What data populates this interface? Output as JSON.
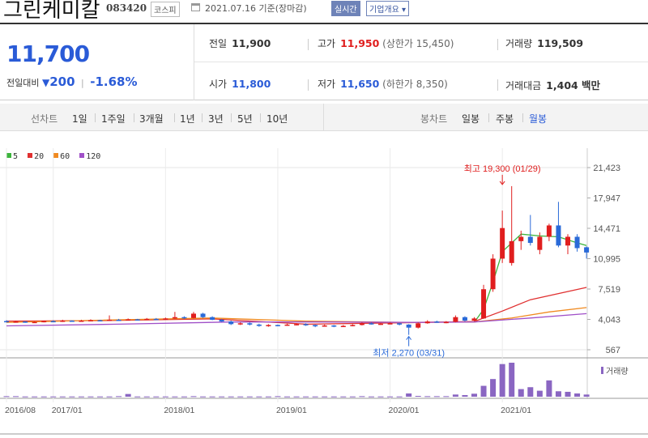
{
  "header": {
    "company_name": "그린케미칼",
    "code": "083420",
    "market": "코스피",
    "date_text": "2021.07.16 기준(장마감)",
    "realtime": "실시간",
    "company_info": "기업개요"
  },
  "quote": {
    "price": "11,700",
    "change_label": "전일대비",
    "change_value": "200",
    "change_pct": "-1.68%",
    "prev_label": "전일",
    "prev_value": "11,900",
    "high_label": "고가",
    "high_value": "11,950",
    "upper_limit": "(상한가 15,450)",
    "volume_label": "거래량",
    "volume_value": "119,509",
    "open_label": "시가",
    "open_value": "11,800",
    "low_label": "저가",
    "low_value": "11,650",
    "lower_limit": "(하한가 8,350)",
    "amount_label": "거래대금",
    "amount_value": "1,404 백만"
  },
  "period_bar": {
    "line_label": "선차트",
    "line_items": [
      "1일",
      "1주일",
      "3개월",
      "1년",
      "3년",
      "5년",
      "10년"
    ],
    "candle_label": "봉차트",
    "candle_items": [
      "일봉",
      "주봉",
      "월봉"
    ],
    "candle_active": "월봉"
  },
  "legend": [
    {
      "label": "5",
      "color": "#3cb43c"
    },
    {
      "label": "20",
      "color": "#e03030"
    },
    {
      "label": "60",
      "color": "#f08a20"
    },
    {
      "label": "120",
      "color": "#a050c8"
    }
  ],
  "chart_data": {
    "type": "candlestick",
    "y_ticks": [
      "21,423",
      "17,947",
      "14,471",
      "10,995",
      "7,519",
      "4,043",
      "567"
    ],
    "y_min": 567,
    "y_max": 21423,
    "x_ticks": [
      {
        "label": "2016/08",
        "i": 0
      },
      {
        "label": "2017/01",
        "i": 5
      },
      {
        "label": "2018/01",
        "i": 17
      },
      {
        "label": "2019/01",
        "i": 29
      },
      {
        "label": "2020/01",
        "i": 41
      },
      {
        "label": "2021/01",
        "i": 53
      }
    ],
    "max_annotation": {
      "text": "최고 19,300 (01/29)",
      "i": 53,
      "value": 19300
    },
    "min_annotation": {
      "text": "최저 2,270 (03/31)",
      "i": 43,
      "value": 2270
    },
    "volume_label": "거래량",
    "candles": [
      {
        "o": 3850,
        "c": 3750,
        "h": 3950,
        "l": 3700
      },
      {
        "o": 3750,
        "c": 3800,
        "h": 3900,
        "l": 3700
      },
      {
        "o": 3800,
        "c": 3700,
        "h": 3850,
        "l": 3650
      },
      {
        "o": 3700,
        "c": 3750,
        "h": 3800,
        "l": 3650
      },
      {
        "o": 3750,
        "c": 3850,
        "h": 3900,
        "l": 3700
      },
      {
        "o": 3850,
        "c": 3800,
        "h": 3950,
        "l": 3750
      },
      {
        "o": 3800,
        "c": 3900,
        "h": 4000,
        "l": 3750
      },
      {
        "o": 3900,
        "c": 3850,
        "h": 3950,
        "l": 3800
      },
      {
        "o": 3850,
        "c": 3900,
        "h": 4000,
        "l": 3800
      },
      {
        "o": 3900,
        "c": 3950,
        "h": 4050,
        "l": 3850
      },
      {
        "o": 3950,
        "c": 3900,
        "h": 4000,
        "l": 3850
      },
      {
        "o": 3900,
        "c": 4000,
        "h": 4500,
        "l": 3850
      },
      {
        "o": 4000,
        "c": 3950,
        "h": 4100,
        "l": 3900
      },
      {
        "o": 3950,
        "c": 4050,
        "h": 4150,
        "l": 3900
      },
      {
        "o": 4050,
        "c": 4000,
        "h": 4100,
        "l": 3950
      },
      {
        "o": 4000,
        "c": 4100,
        "h": 4200,
        "l": 3950
      },
      {
        "o": 4100,
        "c": 4050,
        "h": 4200,
        "l": 4000
      },
      {
        "o": 4050,
        "c": 4150,
        "h": 4250,
        "l": 4000
      },
      {
        "o": 4150,
        "c": 4300,
        "h": 4900,
        "l": 4100
      },
      {
        "o": 4300,
        "c": 4200,
        "h": 4400,
        "l": 4100
      },
      {
        "o": 4200,
        "c": 4700,
        "h": 4900,
        "l": 4150
      },
      {
        "o": 4700,
        "c": 4300,
        "h": 4800,
        "l": 4200
      },
      {
        "o": 4300,
        "c": 4000,
        "h": 4400,
        "l": 3950
      },
      {
        "o": 4000,
        "c": 3800,
        "h": 4100,
        "l": 3750
      },
      {
        "o": 3800,
        "c": 3500,
        "h": 3900,
        "l": 3400
      },
      {
        "o": 3500,
        "c": 3600,
        "h": 3700,
        "l": 3400
      },
      {
        "o": 3600,
        "c": 3450,
        "h": 3700,
        "l": 3350
      },
      {
        "o": 3450,
        "c": 3300,
        "h": 3550,
        "l": 3200
      },
      {
        "o": 3300,
        "c": 3400,
        "h": 3500,
        "l": 3200
      },
      {
        "o": 3400,
        "c": 3350,
        "h": 3450,
        "l": 3250
      },
      {
        "o": 3350,
        "c": 3450,
        "h": 3550,
        "l": 3300
      },
      {
        "o": 3450,
        "c": 3500,
        "h": 3600,
        "l": 3350
      },
      {
        "o": 3500,
        "c": 3400,
        "h": 3600,
        "l": 3300
      },
      {
        "o": 3400,
        "c": 3250,
        "h": 3450,
        "l": 3150
      },
      {
        "o": 3250,
        "c": 3350,
        "h": 3450,
        "l": 3200
      },
      {
        "o": 3350,
        "c": 3250,
        "h": 3400,
        "l": 3150
      },
      {
        "o": 3250,
        "c": 3300,
        "h": 3400,
        "l": 3200
      },
      {
        "o": 3300,
        "c": 3400,
        "h": 3500,
        "l": 3250
      },
      {
        "o": 3400,
        "c": 3600,
        "h": 3700,
        "l": 3350
      },
      {
        "o": 3600,
        "c": 3500,
        "h": 3700,
        "l": 3450
      },
      {
        "o": 3500,
        "c": 3550,
        "h": 3650,
        "l": 3400
      },
      {
        "o": 3550,
        "c": 3600,
        "h": 3700,
        "l": 3500
      },
      {
        "o": 3600,
        "c": 3450,
        "h": 3650,
        "l": 3350
      },
      {
        "o": 3450,
        "c": 3100,
        "h": 3500,
        "l": 2270
      },
      {
        "o": 3100,
        "c": 3600,
        "h": 3700,
        "l": 3000
      },
      {
        "o": 3600,
        "c": 3800,
        "h": 3950,
        "l": 3550
      },
      {
        "o": 3800,
        "c": 3700,
        "h": 3900,
        "l": 3650
      },
      {
        "o": 3700,
        "c": 3750,
        "h": 3850,
        "l": 3600
      },
      {
        "o": 3750,
        "c": 4300,
        "h": 4500,
        "l": 3700
      },
      {
        "o": 4300,
        "c": 3900,
        "h": 4400,
        "l": 3800
      },
      {
        "o": 3900,
        "c": 4150,
        "h": 4300,
        "l": 3850
      },
      {
        "o": 4150,
        "c": 7500,
        "h": 8000,
        "l": 4100
      },
      {
        "o": 7500,
        "c": 11000,
        "h": 11500,
        "l": 7200
      },
      {
        "o": 11000,
        "c": 14500,
        "h": 16500,
        "l": 10500
      },
      {
        "o": 10500,
        "c": 13000,
        "h": 19300,
        "l": 10200
      },
      {
        "o": 13000,
        "c": 13500,
        "h": 14200,
        "l": 12000
      },
      {
        "o": 13500,
        "c": 12800,
        "h": 16000,
        "l": 12500
      },
      {
        "o": 12000,
        "c": 13500,
        "h": 14000,
        "l": 11500
      },
      {
        "o": 13500,
        "c": 14800,
        "h": 15000,
        "l": 13000
      },
      {
        "o": 14800,
        "c": 12500,
        "h": 17500,
        "l": 12300
      },
      {
        "o": 12500,
        "c": 13500,
        "h": 13800,
        "l": 11500
      },
      {
        "o": 13500,
        "c": 12200,
        "h": 13800,
        "l": 11800
      },
      {
        "o": 12300,
        "c": 11700,
        "h": 12400,
        "l": 11000
      }
    ],
    "volumes": [
      2,
      2,
      1,
      1,
      1,
      1,
      1,
      1,
      1,
      1,
      1,
      1,
      2,
      10,
      1,
      1,
      1,
      1,
      1,
      1,
      2,
      1,
      1,
      1,
      1,
      1,
      1,
      1,
      1,
      2,
      1,
      1,
      1,
      1,
      1,
      1,
      1,
      1,
      2,
      1,
      1,
      1,
      1,
      12,
      3,
      2,
      2,
      2,
      8,
      6,
      11,
      40,
      65,
      120,
      125,
      28,
      35,
      22,
      60,
      20,
      18,
      12,
      8
    ],
    "ma": {
      "ma5": [
        [
          50,
          3700
        ],
        [
          51,
          5200
        ],
        [
          52,
          8300
        ],
        [
          53,
          11800
        ],
        [
          55,
          13800
        ],
        [
          57,
          13600
        ],
        [
          59,
          13500
        ],
        [
          61,
          12800
        ],
        [
          62,
          12500
        ]
      ],
      "ma20": [
        [
          0,
          3850
        ],
        [
          10,
          3900
        ],
        [
          22,
          4100
        ],
        [
          32,
          3500
        ],
        [
          42,
          3650
        ],
        [
          50,
          3800
        ],
        [
          53,
          5000
        ],
        [
          56,
          6300
        ],
        [
          62,
          7700
        ]
      ],
      "ma60": [
        [
          0,
          3700
        ],
        [
          10,
          3950
        ],
        [
          22,
          4200
        ],
        [
          32,
          3850
        ],
        [
          42,
          3700
        ],
        [
          50,
          3750
        ],
        [
          54,
          4200
        ],
        [
          58,
          4900
        ],
        [
          62,
          5400
        ]
      ],
      "ma120": [
        [
          0,
          3300
        ],
        [
          12,
          3500
        ],
        [
          24,
          3750
        ],
        [
          34,
          3750
        ],
        [
          44,
          3700
        ],
        [
          50,
          3750
        ],
        [
          56,
          4200
        ],
        [
          62,
          4700
        ]
      ]
    }
  }
}
